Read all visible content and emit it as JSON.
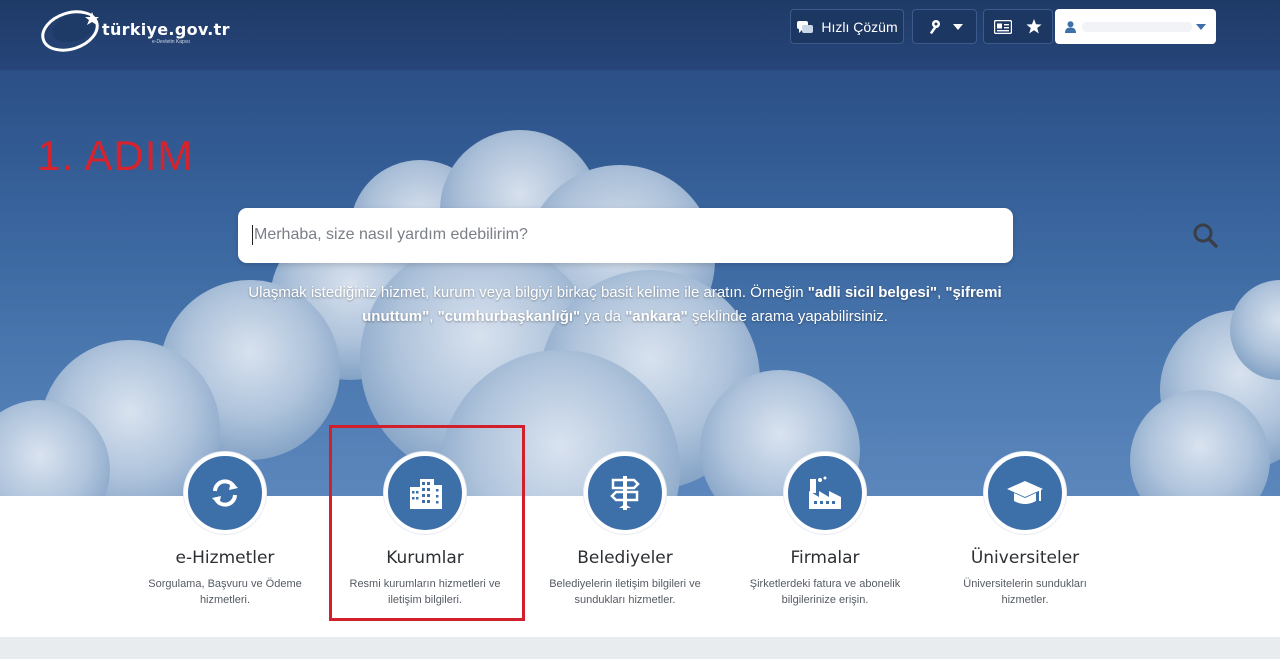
{
  "header": {
    "logo_text": "türkiye.gov.tr",
    "logo_subtitle": "e-Devletin Kapısı",
    "quick_solution_label": "Hızlı Çözüm",
    "user_name": ""
  },
  "hero": {
    "step_label": "1. ADIM",
    "search_placeholder": "Merhaba, size nasıl yardım edebilirim?",
    "hint_part1": "Ulaşmak istediğiniz hizmet, kurum veya bilgiyi birkaç basit kelime ile aratın. Örneğin ",
    "hint_ex1": "\"adli sicil belgesi\"",
    "hint_sep1": ", ",
    "hint_ex2": "\"şifremi unuttum\"",
    "hint_sep2": ", ",
    "hint_ex3": "\"cumhurbaşkanlığı\"",
    "hint_sep3": " ya da ",
    "hint_ex4": "\"ankara\"",
    "hint_part2": " şeklinde arama yapabilirsiniz."
  },
  "categories": [
    {
      "title": "e-Hizmetler",
      "desc": "Sorgulama, Başvuru ve Ödeme hizmetleri.",
      "icon": "refresh-icon"
    },
    {
      "title": "Kurumlar",
      "desc": "Resmi kurumların hizmetleri ve iletişim bilgileri.",
      "icon": "building-icon"
    },
    {
      "title": "Belediyeler",
      "desc": "Belediyelerin iletişim bilgileri ve sundukları hizmetler.",
      "icon": "signpost-icon"
    },
    {
      "title": "Firmalar",
      "desc": "Şirketlerdeki fatura ve abonelik bilgilerinize erişin.",
      "icon": "factory-icon"
    },
    {
      "title": "Üniversiteler",
      "desc": "Üniversitelerin sundukları hizmetler.",
      "icon": "graduation-cap-icon"
    }
  ],
  "colors": {
    "header_bg": "#1e3a66",
    "accent_blue": "#3d6fa8",
    "step_red": "#d6232e",
    "highlight_red": "#d11f2c"
  }
}
